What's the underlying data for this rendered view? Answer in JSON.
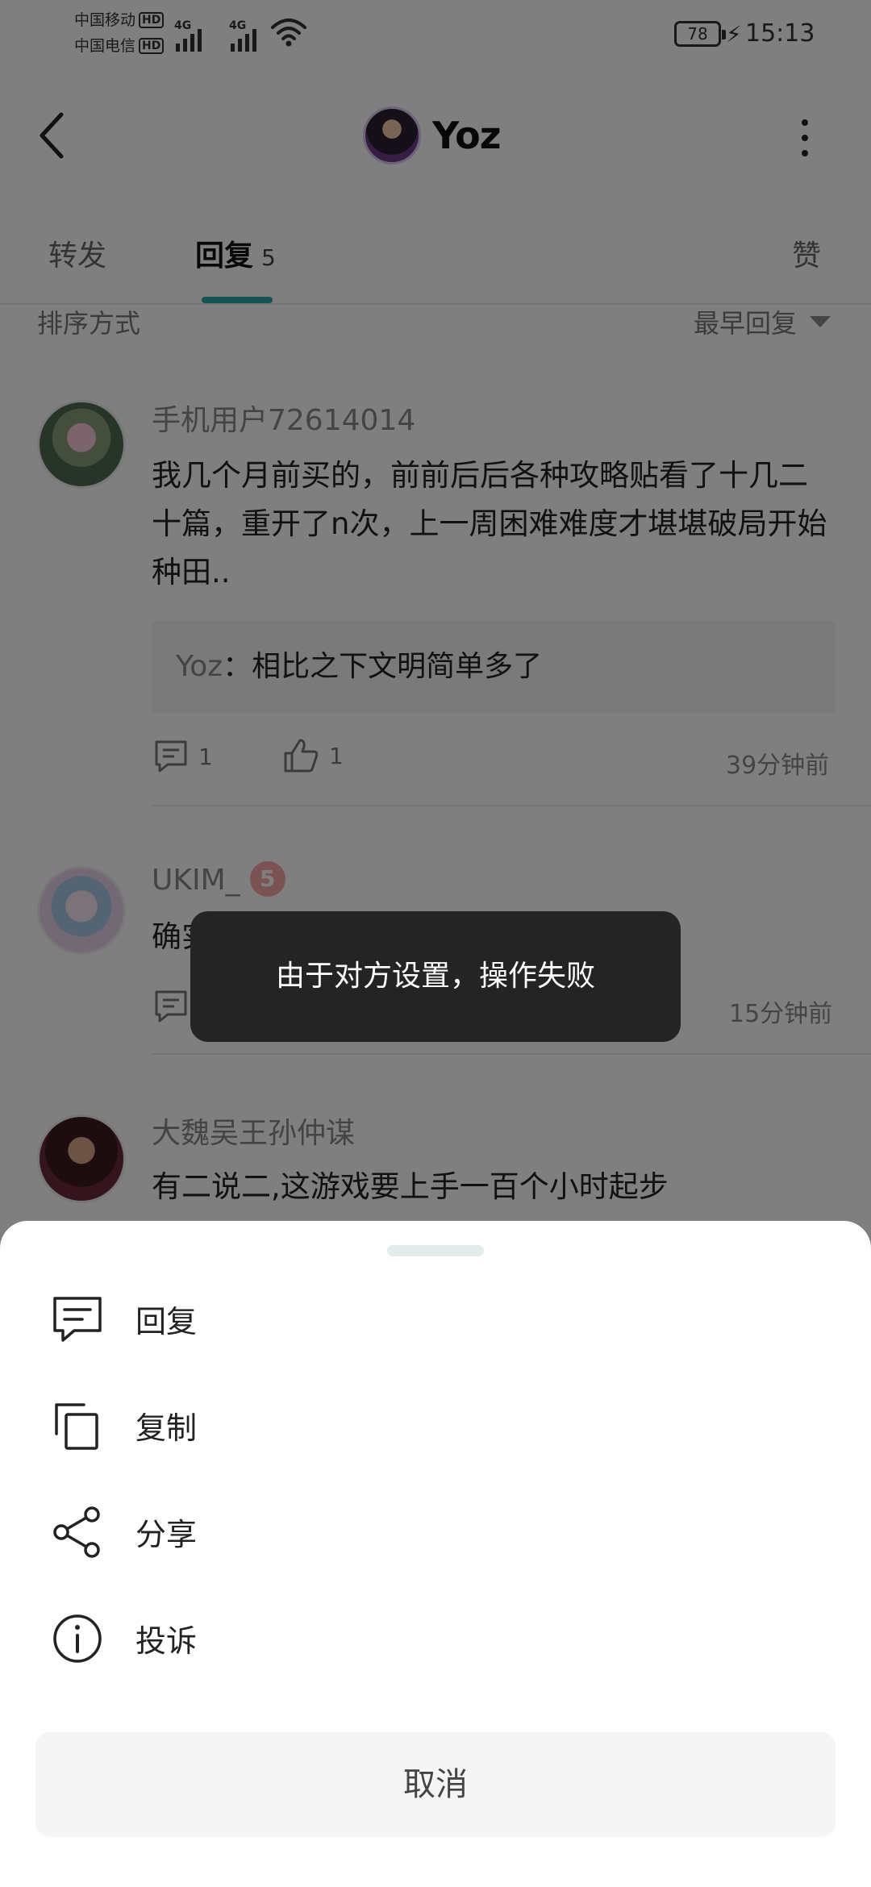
{
  "status_bar": {
    "carrier1": "中国移动",
    "carrier2": "中国电信",
    "hd": "HD",
    "network1": "4G",
    "network2": "4G",
    "battery": "78",
    "time": "15:13"
  },
  "header": {
    "title": "Yoz"
  },
  "tabs": {
    "forward": "转发",
    "reply": "回复",
    "reply_count": "5",
    "like": "赞"
  },
  "sort": {
    "label": "排序方式",
    "value": "最早回复"
  },
  "comments": [
    {
      "user": "手机用户72614014",
      "text": "我几个月前买的，前前后后各种攻略贴看了十几二十篇，重开了n次，上一周困难难度才堪堪破局开始种田..",
      "quote_user": "Yoz",
      "quote_sep": "：",
      "quote_text": "相比之下文明简单多了",
      "reply_count": "1",
      "like_count": "1",
      "time": "39分钟前"
    },
    {
      "user": "UKIM_",
      "badge": "5",
      "text": "确实",
      "time": "15分钟前"
    },
    {
      "user": "大魏吴王孙仲谋",
      "text": "有二说二,这游戏要上手一百个小时起步"
    }
  ],
  "toast": {
    "message": "由于对方设置，操作失败"
  },
  "sheet": {
    "items": [
      {
        "label": "回复",
        "icon": "comment-icon"
      },
      {
        "label": "复制",
        "icon": "copy-icon"
      },
      {
        "label": "分享",
        "icon": "share-icon"
      },
      {
        "label": "投诉",
        "icon": "info-icon"
      }
    ],
    "cancel": "取消"
  }
}
